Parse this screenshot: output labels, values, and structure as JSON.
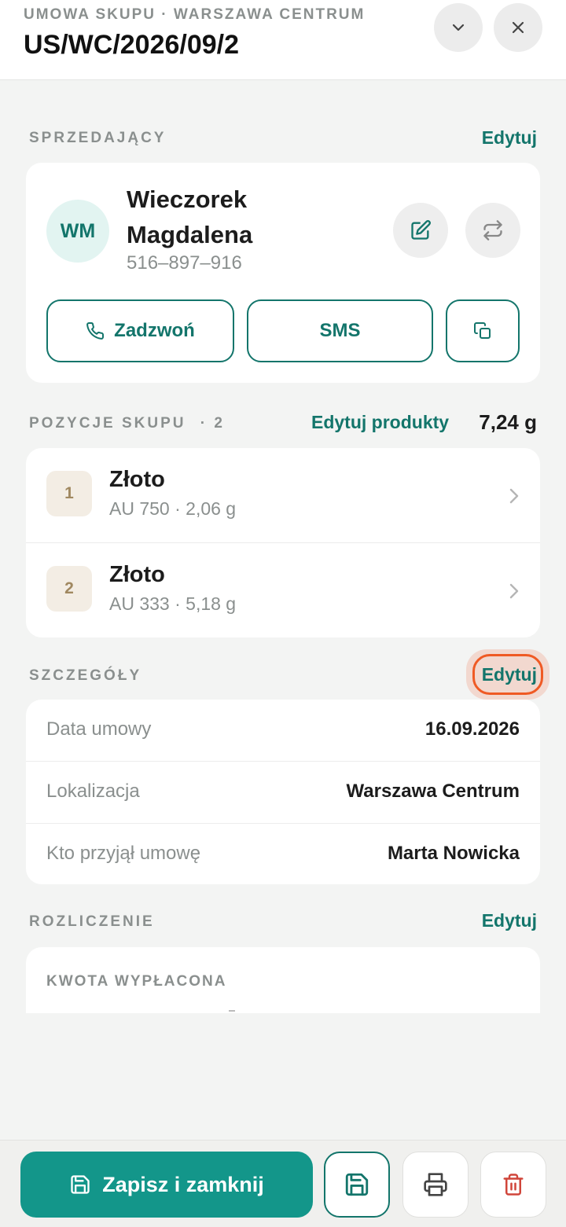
{
  "header": {
    "subtitle": "UMOWA SKUPU · WARSZAWA CENTRUM",
    "title": "US/WC/2026/09/2"
  },
  "seller": {
    "section_title": "SPRZEDAJĄCY",
    "edit_label": "Edytuj",
    "initials": "WM",
    "first_line": "Wieczorek",
    "second_line": "Magdalena",
    "phone": "516–897–916",
    "call_label": "Zadzwoń",
    "sms_label": "SMS"
  },
  "items": {
    "section_title": "POZYCJE SKUPU",
    "count_label": "· 2",
    "edit_label": "Edytuj produkty",
    "total_weight": "7,24 g",
    "list": [
      {
        "index": "1",
        "title": "Złoto",
        "subtitle": "AU 750 · 2,06 g"
      },
      {
        "index": "2",
        "title": "Złoto",
        "subtitle": "AU 333 · 5,18 g"
      }
    ]
  },
  "details": {
    "section_title": "SZCZEGÓŁY",
    "edit_label": "Edytuj",
    "rows": [
      {
        "label": "Data umowy",
        "value": "16.09.2026"
      },
      {
        "label": "Lokalizacja",
        "value": "Warszawa Centrum"
      },
      {
        "label": "Kto przyjął umowę",
        "value": "Marta Nowicka"
      }
    ]
  },
  "settlement": {
    "section_title": "ROZLICZENIE",
    "edit_label": "Edytuj",
    "amount_label": "KWOTA WYPŁACONA"
  },
  "footer": {
    "save_close_label": "Zapisz i zamknij"
  },
  "colors": {
    "accent": "#13756b",
    "primary_button": "#13968a",
    "highlight": "#ef5a24",
    "delete": "#d0453a"
  }
}
